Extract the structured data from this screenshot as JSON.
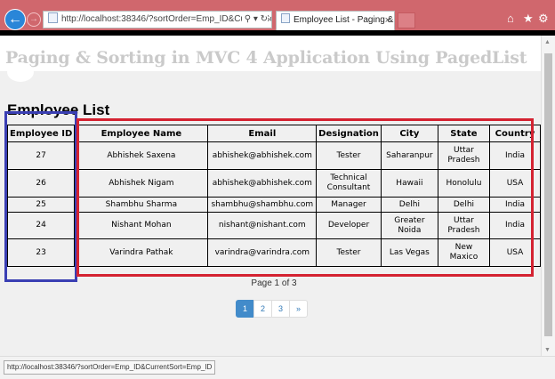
{
  "browser": {
    "address": "http://localhost:38346/?sortOrder=Emp_ID&CurrentSort=",
    "address_icons": "⚲ ▾ ↻",
    "tab_title": "Employee List - Paging & S...",
    "tab_close": "×",
    "back_icon": "←",
    "forward_icon": "→",
    "tools": {
      "home": "⌂",
      "favorites": "★",
      "settings": "⚙"
    }
  },
  "site_title": "Paging & Sorting in MVC 4 Application Using PagedList",
  "page_heading": "Employee List",
  "table": {
    "headers": [
      "Employee ID",
      "Employee Name",
      "Email",
      "Designation",
      "City",
      "State",
      "Country"
    ],
    "rows": [
      [
        "27",
        "Abhishek Saxena",
        "abhishek@abhishek.com",
        "Tester",
        "Saharanpur",
        "Uttar Pradesh",
        "India"
      ],
      [
        "26",
        "Abhishek Nigam",
        "abhishek@abhishek.com",
        "Technical Consultant",
        "Hawaii",
        "Honolulu",
        "USA"
      ],
      [
        "25",
        "Shambhu Sharma",
        "shambhu@shambhu.com",
        "Manager",
        "Delhi",
        "Delhi",
        "India"
      ],
      [
        "24",
        "Nishant Mohan",
        "nishant@nishant.com",
        "Developer",
        "Greater Noida",
        "Uttar Pradesh",
        "India"
      ],
      [
        "23",
        "Varindra Pathak",
        "varindra@varindra.com",
        "Tester",
        "Las Vegas",
        "New Maxico",
        "USA"
      ]
    ]
  },
  "pagination": {
    "info": "Page 1 of 3",
    "pages": [
      "1",
      "2",
      "3",
      "»"
    ],
    "active": "1"
  },
  "status_bar": "http://localhost:38346/?sortOrder=Emp_ID&CurrentSort=Emp_ID",
  "colors": {
    "chrome": "#d0676d",
    "highlight_blue": "#3a3fb3",
    "highlight_red": "#d42231",
    "pager_active": "#428bca"
  }
}
